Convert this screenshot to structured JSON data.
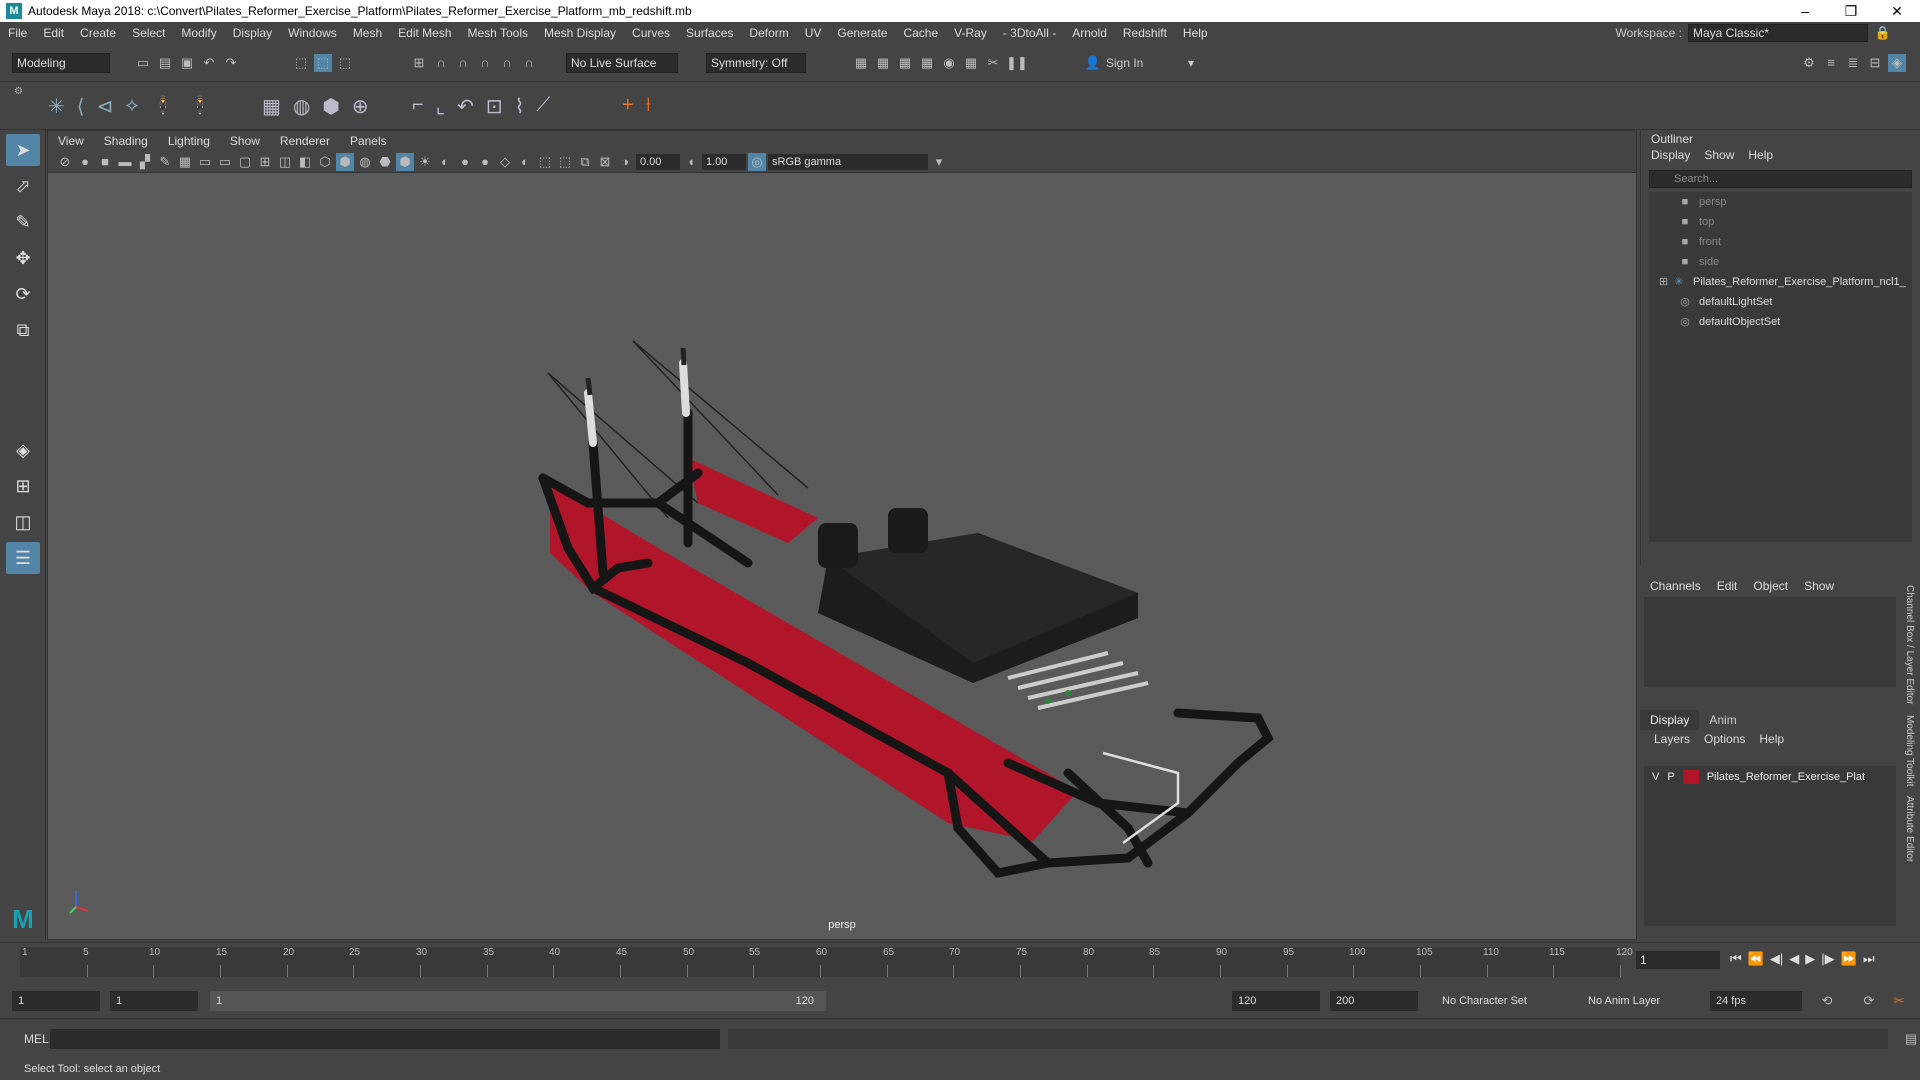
{
  "window": {
    "title": "Autodesk Maya 2018: c:\\Convert\\Pilates_Reformer_Exercise_Platform\\Pilates_Reformer_Exercise_Platform_mb_redshift.mb",
    "logo": "M",
    "minimize": "–",
    "maximize": "❐",
    "close": "✕"
  },
  "menubar": {
    "items": [
      "File",
      "Edit",
      "Create",
      "Select",
      "Modify",
      "Display",
      "Windows",
      "Mesh",
      "Edit Mesh",
      "Mesh Tools",
      "Mesh Display",
      "Curves",
      "Surfaces",
      "Deform",
      "UV",
      "Generate",
      "Cache",
      "V-Ray",
      "- 3DtoAll -",
      "Arnold",
      "Redshift",
      "Help"
    ],
    "workspace_label": "Workspace :",
    "workspace_value": "Maya Classic*"
  },
  "statusline": {
    "mode": "Modeling",
    "live_surface": "No Live Surface",
    "symmetry": "Symmetry: Off",
    "sign_in": "Sign In"
  },
  "viewport": {
    "menu": [
      "View",
      "Shading",
      "Lighting",
      "Show",
      "Renderer",
      "Panels"
    ],
    "exposure": "0.00",
    "gamma": "1.00",
    "color_space": "sRGB gamma",
    "camera": "persp"
  },
  "outliner": {
    "title": "Outliner",
    "menu": [
      "Display",
      "Show",
      "Help"
    ],
    "search_placeholder": "Search...",
    "items": [
      {
        "label": "persp",
        "dim": true
      },
      {
        "label": "top",
        "dim": true
      },
      {
        "label": "front",
        "dim": true
      },
      {
        "label": "side",
        "dim": true
      },
      {
        "label": "Pilates_Reformer_Exercise_Platform_ncl1_",
        "dim": false
      },
      {
        "label": "defaultLightSet",
        "dim": false
      },
      {
        "label": "defaultObjectSet",
        "dim": false
      }
    ]
  },
  "channelbox": {
    "menu": [
      "Channels",
      "Edit",
      "Object",
      "Show"
    ]
  },
  "layereditor": {
    "tabs": [
      "Display",
      "Anim"
    ],
    "menu": [
      "Layers",
      "Options",
      "Help"
    ],
    "layer": {
      "v": "V",
      "p": "P",
      "name": "Pilates_Reformer_Exercise_Plat",
      "color": "#b0152a"
    }
  },
  "sidetabs": [
    "Channel Box / Layer Editor",
    "Modeling Toolkit",
    "Attribute Editor"
  ],
  "timeline": {
    "ticks": [
      "5",
      "10",
      "15",
      "20",
      "25",
      "30",
      "35",
      "40",
      "45",
      "50",
      "55",
      "60",
      "65",
      "70",
      "75",
      "80",
      "85",
      "90",
      "95",
      "100",
      "105",
      "110",
      "115",
      "120"
    ],
    "start_mark": "1",
    "current_frame": "1"
  },
  "range": {
    "start": "1",
    "anim_start": "1",
    "slider_start": "1",
    "slider_end": "120",
    "anim_end": "120",
    "end": "200",
    "character_set": "No Character Set",
    "anim_layer": "No Anim Layer",
    "fps": "24 fps"
  },
  "cmdline": {
    "label": "MEL"
  },
  "helpline": {
    "text": "Select Tool: select an object"
  },
  "colors": {
    "panel": "#444444",
    "viewport": "#5a5a5a",
    "accent": "#5285a6",
    "model_red": "#b0152a"
  }
}
